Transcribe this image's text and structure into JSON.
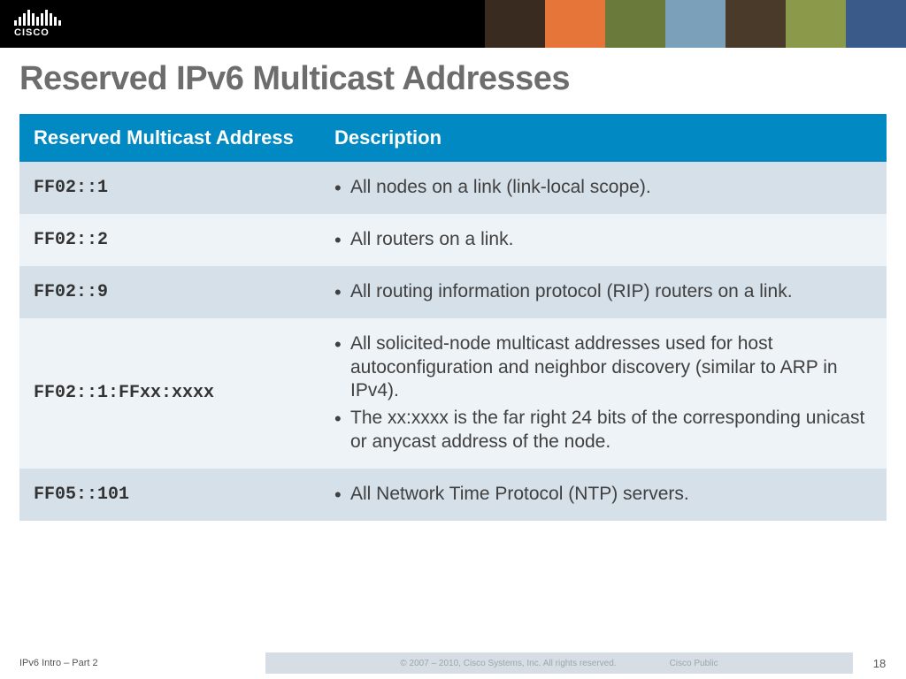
{
  "brand": {
    "name": "CISCO"
  },
  "title": "Reserved IPv6 Multicast Addresses",
  "table": {
    "headers": {
      "address": "Reserved Multicast Address",
      "description": "Description"
    },
    "rows": [
      {
        "address": "FF02::1",
        "description_items": [
          "All nodes on a link (link-local scope)."
        ]
      },
      {
        "address": "FF02::2",
        "description_items": [
          "All routers on a link."
        ]
      },
      {
        "address": "FF02::9",
        "description_items": [
          "All routing information protocol (RIP) routers on a link."
        ]
      },
      {
        "address": "FF02::1:FFxx:xxxx",
        "description_items": [
          "All solicited-node multicast addresses used for host autoconfiguration and neighbor discovery (similar to ARP in IPv4).",
          "The xx:xxxx is the far right 24 bits of the corresponding unicast or anycast address of the node."
        ]
      },
      {
        "address": "FF05::101",
        "description_items": [
          "All Network Time Protocol (NTP) servers."
        ]
      }
    ]
  },
  "footer": {
    "left": "IPv6 Intro – Part 2",
    "copyright": "© 2007 – 2010, Cisco Systems, Inc. All rights reserved.",
    "public": "Cisco Public",
    "page": "18"
  },
  "chart_data": {
    "type": "table",
    "title": "Reserved IPv6 Multicast Addresses",
    "columns": [
      "Reserved Multicast Address",
      "Description"
    ],
    "rows": [
      [
        "FF02::1",
        "All nodes on a link (link-local scope)."
      ],
      [
        "FF02::2",
        "All routers on a link."
      ],
      [
        "FF02::9",
        "All routing information protocol (RIP) routers on a link."
      ],
      [
        "FF02::1:FFxx:xxxx",
        "All solicited-node multicast addresses used for host autoconfiguration and neighbor discovery (similar to ARP in IPv4). The xx:xxxx is the far right 24 bits of the corresponding unicast or anycast address of the node."
      ],
      [
        "FF05::101",
        "All Network Time Protocol (NTP) servers."
      ]
    ]
  }
}
